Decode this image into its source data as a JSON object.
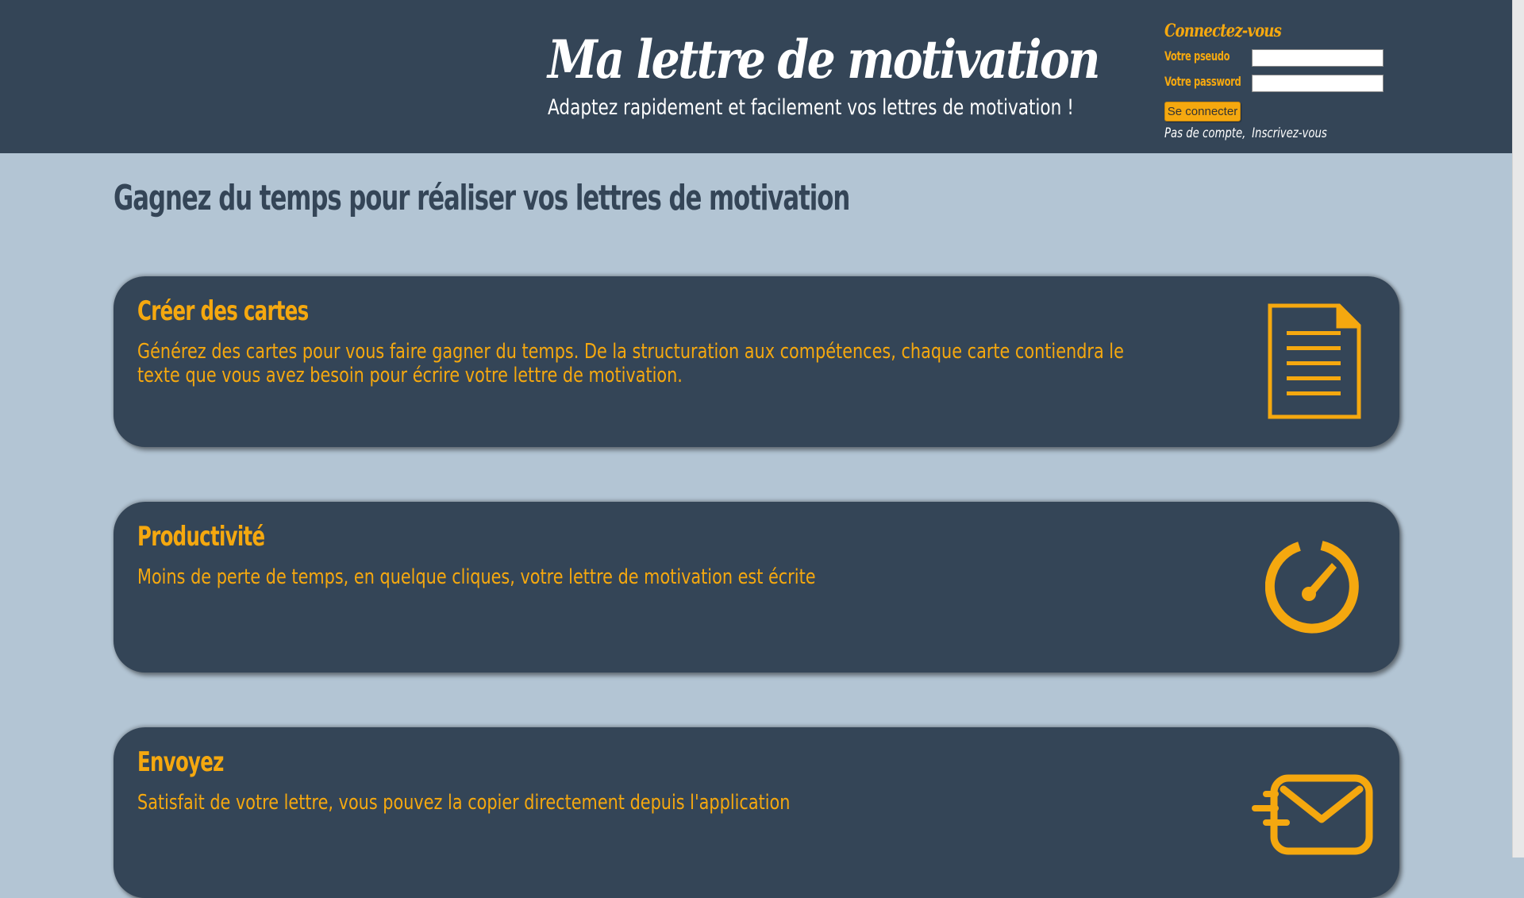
{
  "header": {
    "title": "Ma lettre de motivation",
    "subtitle": "Adaptez rapidement et facilement vos lettres de motivation !"
  },
  "login": {
    "title": "Connectez-vous",
    "pseudo_label": "Votre pseudo",
    "pseudo_value": "",
    "password_label": "Votre password",
    "password_value": "",
    "button_label": "Se connecter",
    "no_account_text": "Pas de compte,",
    "signup_link": "Inscrivez-vous"
  },
  "main": {
    "section_title": "Gagnez du temps pour réaliser vos lettres de motivation",
    "cards": [
      {
        "title": "Créer des cartes",
        "text": "Générez des cartes pour vous faire gagner du temps. De la structuration aux compétences, chaque carte contiendra le texte que vous avez besoin pour écrire votre lettre de motivation.",
        "icon": "document-icon"
      },
      {
        "title": "Productivité",
        "text": "Moins de perte de temps, en quelque cliques, votre lettre de motivation est écrite",
        "icon": "speedometer-icon"
      },
      {
        "title": "Envoyez",
        "text": "Satisfait de votre lettre, vous pouvez la copier directement depuis l'application",
        "icon": "fast-mail-icon"
      }
    ]
  },
  "colors": {
    "header_bg": "#344557",
    "page_bg": "#b3c5d4",
    "accent": "#f5a80f",
    "card_bg": "#344557"
  }
}
